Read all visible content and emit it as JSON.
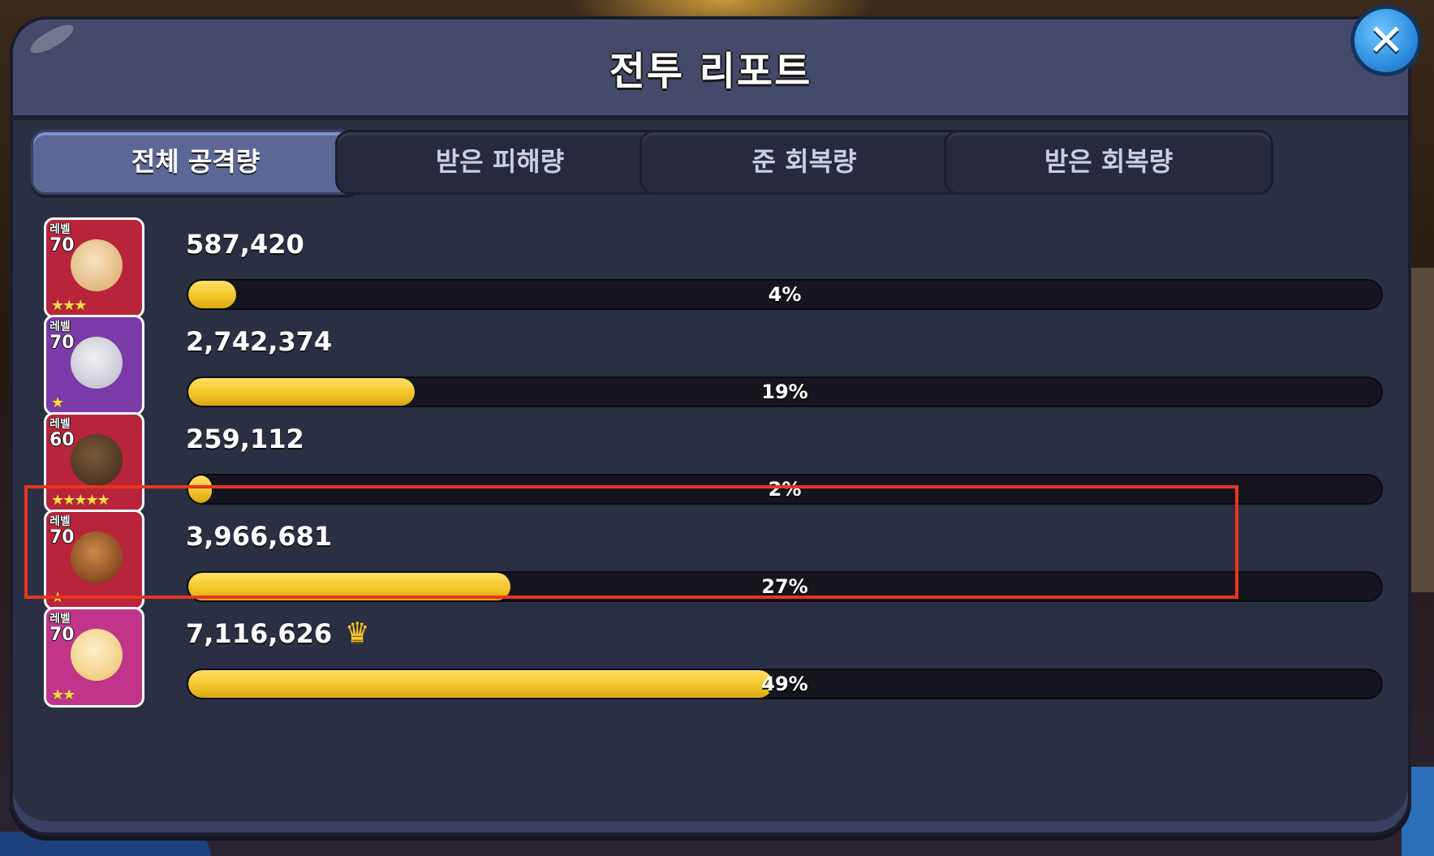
{
  "window": {
    "title": "전투 리포트",
    "close_icon": "close-icon"
  },
  "tabs": [
    {
      "label": "전체 공격량",
      "active": true
    },
    {
      "label": "받은 피해량",
      "active": false
    },
    {
      "label": "준 회복량",
      "active": false
    },
    {
      "label": "받은 회복량",
      "active": false
    }
  ],
  "colors": {
    "bar_fill": "#f3c72a",
    "highlight": "#e8351f",
    "close_button": "#2e8fe0"
  },
  "entries": [
    {
      "level_label": "레벨",
      "level": "70",
      "value": "587,420",
      "percent": "4%",
      "fraction": 0.04,
      "portrait_bg": "#b8243a",
      "stars": "★★★"
    },
    {
      "level_label": "레벨",
      "level": "70",
      "value": "2,742,374",
      "percent": "19%",
      "fraction": 0.19,
      "portrait_bg": "#7a3aa8",
      "stars": "★"
    },
    {
      "level_label": "레벨",
      "level": "60",
      "value": "259,112",
      "percent": "2%",
      "fraction": 0.02,
      "portrait_bg": "#b8243a",
      "stars": "★★★★★"
    },
    {
      "level_label": "레벨",
      "level": "70",
      "value": "3,966,681",
      "percent": "27%",
      "fraction": 0.27,
      "portrait_bg": "#b8243a",
      "stars": "★",
      "highlighted": true
    },
    {
      "level_label": "레벨",
      "level": "70",
      "value": "7,116,626",
      "percent": "49%",
      "fraction": 0.49,
      "portrait_bg": "#c0358a",
      "stars": "★★",
      "top": true,
      "badge_icon": "crown-icon"
    }
  ]
}
